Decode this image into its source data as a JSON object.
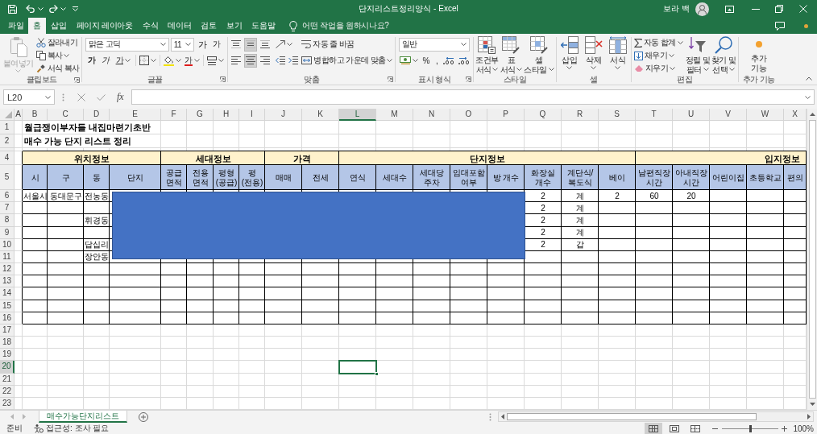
{
  "window": {
    "title": "단지리스트정리양식 - Excel",
    "user_name": "보라 백"
  },
  "ribbon_tabs": [
    {
      "label": "파일",
      "selected": false
    },
    {
      "label": "홈",
      "selected": true
    },
    {
      "label": "삽입",
      "selected": false
    },
    {
      "label": "페이지 레이아웃",
      "selected": false
    },
    {
      "label": "수식",
      "selected": false
    },
    {
      "label": "데이터",
      "selected": false
    },
    {
      "label": "검토",
      "selected": false
    },
    {
      "label": "보기",
      "selected": false
    },
    {
      "label": "도움말",
      "selected": false
    }
  ],
  "tell_me": "어떤 작업을 원하시나요?",
  "ribbon": {
    "groups": [
      {
        "kind": "clipboard",
        "label": "클립보드",
        "paste": {
          "label": "붙여넣기",
          "disabled": true
        },
        "commands": [
          "잘라내기",
          "복사",
          "서식 복사"
        ]
      },
      {
        "kind": "font",
        "label": "글꼴",
        "font_name": "맑은 고딕",
        "font_size": "11",
        "size_buttons": [
          "가",
          "가"
        ],
        "style_buttons": [
          "가",
          "가",
          "가"
        ],
        "font_color": "가"
      },
      {
        "kind": "alignment",
        "label": "맞춤",
        "vertical_align": [
          {
            "on": false
          },
          {
            "on": true
          },
          {
            "on": false
          }
        ],
        "horizontal_align": [
          {
            "on": false
          },
          {
            "on": true
          },
          {
            "on": false
          }
        ],
        "commands": [
          "자동 줄 바꿈",
          "병합하고 가운데 맞춤"
        ]
      },
      {
        "kind": "number",
        "label": "표시 형식",
        "format": "일반",
        "symbol_buttons": [
          "%",
          ","
        ]
      },
      {
        "kind": "styles",
        "label": "스타일",
        "buttons": [
          {
            "lines": [
              "조건부",
              "서식"
            ]
          },
          {
            "lines": [
              "표",
              "서식"
            ]
          },
          {
            "lines": [
              "셀",
              "스타일"
            ]
          }
        ]
      },
      {
        "kind": "cells",
        "label": "셀",
        "buttons": [
          "삽입",
          "삭제",
          "서식"
        ]
      },
      {
        "kind": "editing",
        "label": "편집",
        "commands": [
          "자동 합계",
          "채우기",
          "지우기"
        ],
        "buttons": [
          {
            "lines": [
              "정렬 및",
              "필터"
            ]
          },
          {
            "lines": [
              "찾기 및",
              "선택"
            ]
          }
        ]
      },
      {
        "kind": "addins",
        "label": "추가 기능",
        "buttons": [
          {
            "lines": [
              "추가",
              "기능"
            ]
          }
        ]
      }
    ]
  },
  "formula_bar": {
    "name_box": "L20",
    "function_button": "fx"
  },
  "sheet": {
    "columns": [
      {
        "label": "A",
        "selected": false
      },
      {
        "label": "B",
        "selected": false
      },
      {
        "label": "C",
        "selected": false
      },
      {
        "label": "D",
        "selected": false
      },
      {
        "label": "E",
        "selected": false
      },
      {
        "label": "F",
        "selected": false
      },
      {
        "label": "G",
        "selected": false
      },
      {
        "label": "H",
        "selected": false
      },
      {
        "label": "I",
        "selected": false
      },
      {
        "label": "J",
        "selected": false
      },
      {
        "label": "K",
        "selected": false
      },
      {
        "label": "L",
        "selected": true
      },
      {
        "label": "M",
        "selected": false
      },
      {
        "label": "N",
        "selected": false
      },
      {
        "label": "O",
        "selected": false
      },
      {
        "label": "P",
        "selected": false
      },
      {
        "label": "Q",
        "selected": false
      },
      {
        "label": "R",
        "selected": false
      },
      {
        "label": "S",
        "selected": false
      },
      {
        "label": "T",
        "selected": false
      },
      {
        "label": "U",
        "selected": false
      },
      {
        "label": "V",
        "selected": false
      },
      {
        "label": "W",
        "selected": false
      },
      {
        "label": "X",
        "selected": false
      }
    ],
    "rows": [
      {
        "number": "1",
        "selected": false,
        "kind": "title",
        "text": "월급쟁이부자들 내집마련기초반"
      },
      {
        "number": "2",
        "selected": false,
        "kind": "title",
        "text": "매수 가능 단지 리스트 정리"
      },
      {
        "selected": false,
        "kind": "spacer"
      },
      {
        "number": "4",
        "selected": false,
        "kind": "group_header",
        "groups": [
          {
            "label": "위치정보"
          },
          {
            "label": "세대정보"
          },
          {
            "label": "가격"
          },
          {
            "label": "단지정보"
          },
          {
            "label": "입지정보"
          }
        ]
      },
      {
        "number": "5",
        "selected": false,
        "kind": "column_header",
        "headers": [
          {
            "lines": [
              "시"
            ]
          },
          {
            "lines": [
              "구"
            ]
          },
          {
            "lines": [
              "동"
            ]
          },
          {
            "lines": [
              "단지"
            ]
          },
          {
            "lines": [
              "공급",
              "면적"
            ]
          },
          {
            "lines": [
              "전용",
              "면적"
            ]
          },
          {
            "lines": [
              "평형",
              "(공급)"
            ]
          },
          {
            "lines": [
              "평",
              "(전용)"
            ]
          },
          {
            "lines": [
              "매매"
            ]
          },
          {
            "lines": [
              "전세"
            ]
          },
          {
            "lines": [
              "연식"
            ]
          },
          {
            "lines": [
              "세대수"
            ]
          },
          {
            "lines": [
              "세대당",
              "주차"
            ]
          },
          {
            "lines": [
              "임대포함",
              "여부"
            ]
          },
          {
            "lines": [
              "방 개수"
            ]
          },
          {
            "lines": [
              "화장실",
              "개수"
            ]
          },
          {
            "lines": [
              "계단식/",
              "복도식"
            ]
          },
          {
            "lines": [
              "베이"
            ]
          },
          {
            "lines": [
              "남편직장",
              "시간"
            ]
          },
          {
            "lines": [
              "아내직장",
              "시간"
            ]
          },
          {
            "lines": [
              "어린이집"
            ]
          },
          {
            "lines": [
              "초등학교"
            ]
          },
          {
            "lines": [
              "편의"
            ]
          }
        ]
      },
      {
        "number": "6",
        "selected": false,
        "kind": "data",
        "cells": {
          "city": "서울시",
          "district": "동대문구",
          "dong": "전농동",
          "bathrooms": "2",
          "stair_or_corridor": "계",
          "bays": "2",
          "husband_commute_time": "60",
          "wife_commute_time": "20"
        }
      },
      {
        "number": "7",
        "selected": false,
        "kind": "data",
        "cells": {
          "bathrooms": "2",
          "stair_or_corridor": "계"
        }
      },
      {
        "number": "8",
        "selected": false,
        "kind": "data",
        "cells": {
          "dong": "휘경동",
          "bathrooms": "2",
          "stair_or_corridor": "계"
        }
      },
      {
        "number": "9",
        "selected": false,
        "kind": "data",
        "cells": {
          "bathrooms": "2",
          "stair_or_corridor": "계"
        }
      },
      {
        "number": "10",
        "selected": false,
        "kind": "data",
        "cells": {
          "dong": "답십리",
          "bathrooms": "2",
          "stair_or_corridor": "갑"
        }
      },
      {
        "number": "11",
        "selected": false,
        "kind": "data",
        "cells": {
          "dong": "장안동"
        }
      },
      {
        "number": "12",
        "selected": false,
        "kind": "data"
      },
      {
        "number": "13",
        "selected": false,
        "kind": "data"
      },
      {
        "number": "14",
        "selected": false,
        "kind": "data"
      },
      {
        "number": "15",
        "selected": false,
        "kind": "data"
      },
      {
        "number": "16",
        "selected": false,
        "kind": "data"
      },
      {
        "number": "17",
        "selected": false,
        "kind": "blank"
      },
      {
        "number": "18",
        "selected": false,
        "kind": "blank"
      },
      {
        "number": "19",
        "selected": false,
        "kind": "blank"
      },
      {
        "number": "20",
        "selected": true,
        "kind": "blank"
      },
      {
        "number": "21",
        "selected": false,
        "kind": "blank"
      },
      {
        "number": "22",
        "selected": false,
        "kind": "blank"
      },
      {
        "number": "23",
        "selected": false,
        "kind": "blank"
      }
    ],
    "shapes": [
      {
        "kind": "rectangle"
      }
    ]
  },
  "sheet_tabs": [
    {
      "name": "매수가능단지리스트",
      "selected": true
    }
  ],
  "status_bar": {
    "mode": "준비",
    "accessibility": "접근성: 조사 필요",
    "views": [
      {
        "selected": true
      },
      {
        "selected": false
      },
      {
        "selected": false
      }
    ],
    "zoom": {
      "level": 0.5,
      "reading": "100%"
    }
  }
}
